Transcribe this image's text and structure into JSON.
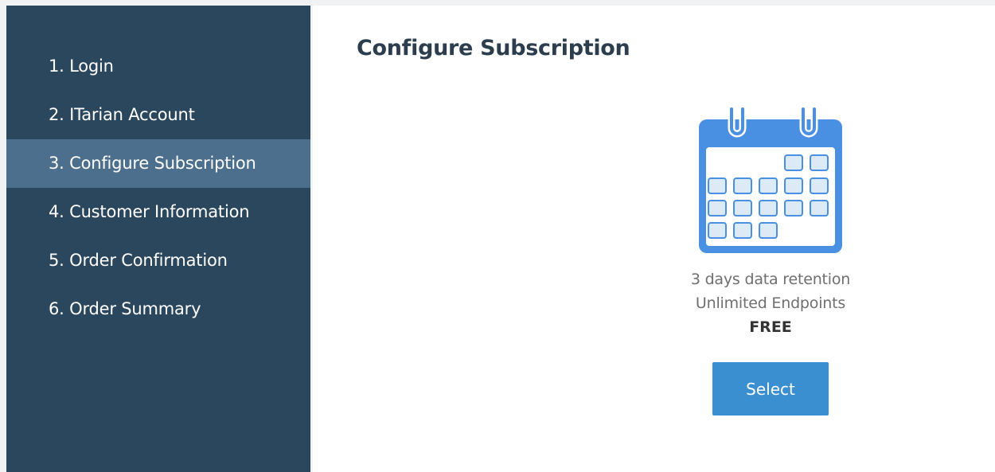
{
  "sidebar": {
    "steps": [
      {
        "label": "1. Login"
      },
      {
        "label": "2. ITarian Account"
      },
      {
        "label": "3. Configure Subscription",
        "active": true
      },
      {
        "label": "4. Customer Information"
      },
      {
        "label": "5. Order Confirmation"
      },
      {
        "label": "6. Order Summary"
      }
    ]
  },
  "main": {
    "title": "Configure Subscription",
    "plan": {
      "icon": "calendar-icon",
      "features": [
        "3 days data retention",
        "Unlimited Endpoints"
      ],
      "price": "FREE",
      "select_label": "Select"
    }
  },
  "colors": {
    "sidebar_bg": "#2b475d",
    "active_step_bg": "#4b6f8c",
    "accent": "#3a8fd0",
    "title": "#2c3e4e"
  }
}
